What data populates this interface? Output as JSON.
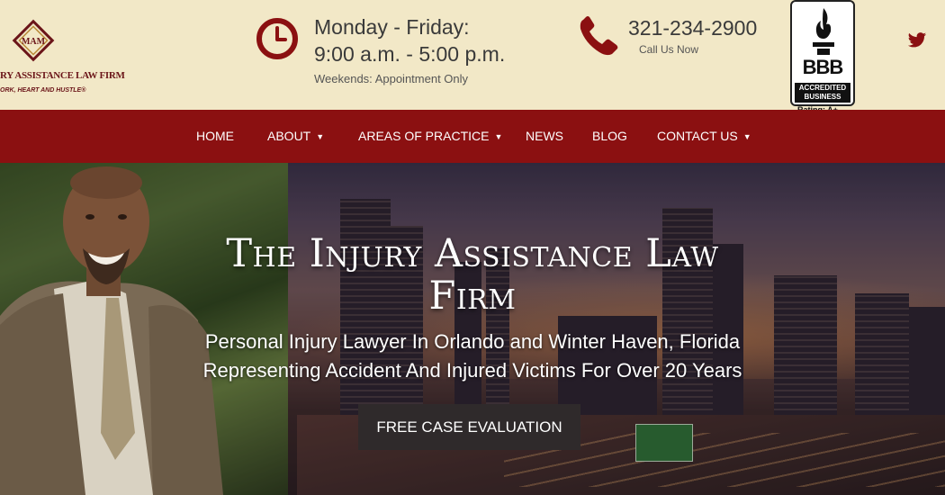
{
  "header": {
    "logo": {
      "monogram": "MAM",
      "name": "RY ASSISTANCE LAW FIRM",
      "tagline": "ORK, HEART AND HUSTLE®"
    },
    "hours": {
      "icon": "clock-icon",
      "line1": "Monday - Friday:",
      "line2": "9:00 a.m. - 5:00 p.m.",
      "line3": "Weekends: Appointment Only"
    },
    "phone": {
      "icon": "phone-icon",
      "number": "321-234-2900",
      "sub": "Call Us Now"
    },
    "bbb": {
      "logo_text": "BBB",
      "accredited": "ACCREDITED BUSINESS",
      "rating": "Rating: A+"
    },
    "social": {
      "twitter_icon": "twitter-icon"
    }
  },
  "nav": {
    "items": [
      {
        "label": "HOME"
      },
      {
        "label": "ABOUT",
        "dropdown": true
      },
      {
        "label": "AREAS OF PRACTICE",
        "dropdown": true
      },
      {
        "label": "NEWS"
      },
      {
        "label": "BLOG"
      },
      {
        "label": "CONTACT US",
        "dropdown": true
      }
    ]
  },
  "hero": {
    "title": "The Injury Assistance Law Firm",
    "subtitle1": "Personal Injury Lawyer In Orlando and Winter Haven, Florida",
    "subtitle2": "Representing Accident And Injured Victims For Over 20 Years",
    "cta": "FREE CASE EVALUATION"
  },
  "colors": {
    "header_bg": "#f2e8c7",
    "nav_bg": "#8b1011",
    "brand": "#8b1011",
    "cta_bg": "#2f2a2b"
  }
}
